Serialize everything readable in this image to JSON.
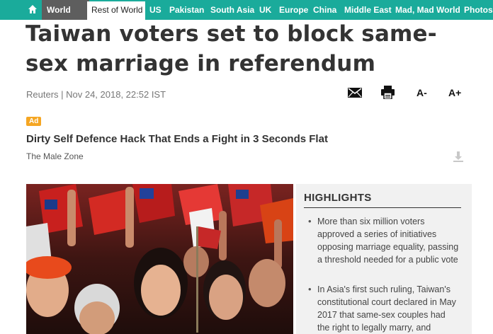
{
  "nav": {
    "world": "World",
    "active": "Rest of World",
    "links": [
      "US",
      "Pakistan",
      "South Asia",
      "UK",
      "Europe",
      "China",
      "Middle East",
      "Mad, Mad World",
      "Photos"
    ]
  },
  "article": {
    "headline": "Taiwan voters set to block same-sex marriage in referendum",
    "byline": "Reuters | Nov 24, 2018, 22:52 IST"
  },
  "tools": {
    "font_decrease": "A-",
    "font_increase": "A+"
  },
  "ad": {
    "badge": "Ad",
    "title": "Dirty Self Defence Hack That Ends a Fight in 3 Seconds Flat",
    "source": "The Male Zone"
  },
  "highlights": {
    "title": "HIGHLIGHTS",
    "items": [
      "More than six million voters approved a series of initiatives opposing marriage equality, passing a threshold needed for a public vote",
      "In Asia's first such ruling, Taiwan's constitutional court declared in May 2017 that same-sex couples had the right to legally marry, and"
    ]
  },
  "colors": {
    "nav_bg": "#1aab9b",
    "world_bg": "#5e5e5e",
    "ad_badge": "#f5a623",
    "highlights_bg": "#f1f1f1"
  },
  "icons": [
    "home-icon",
    "mail-icon",
    "print-icon",
    "ad-info-icon"
  ]
}
